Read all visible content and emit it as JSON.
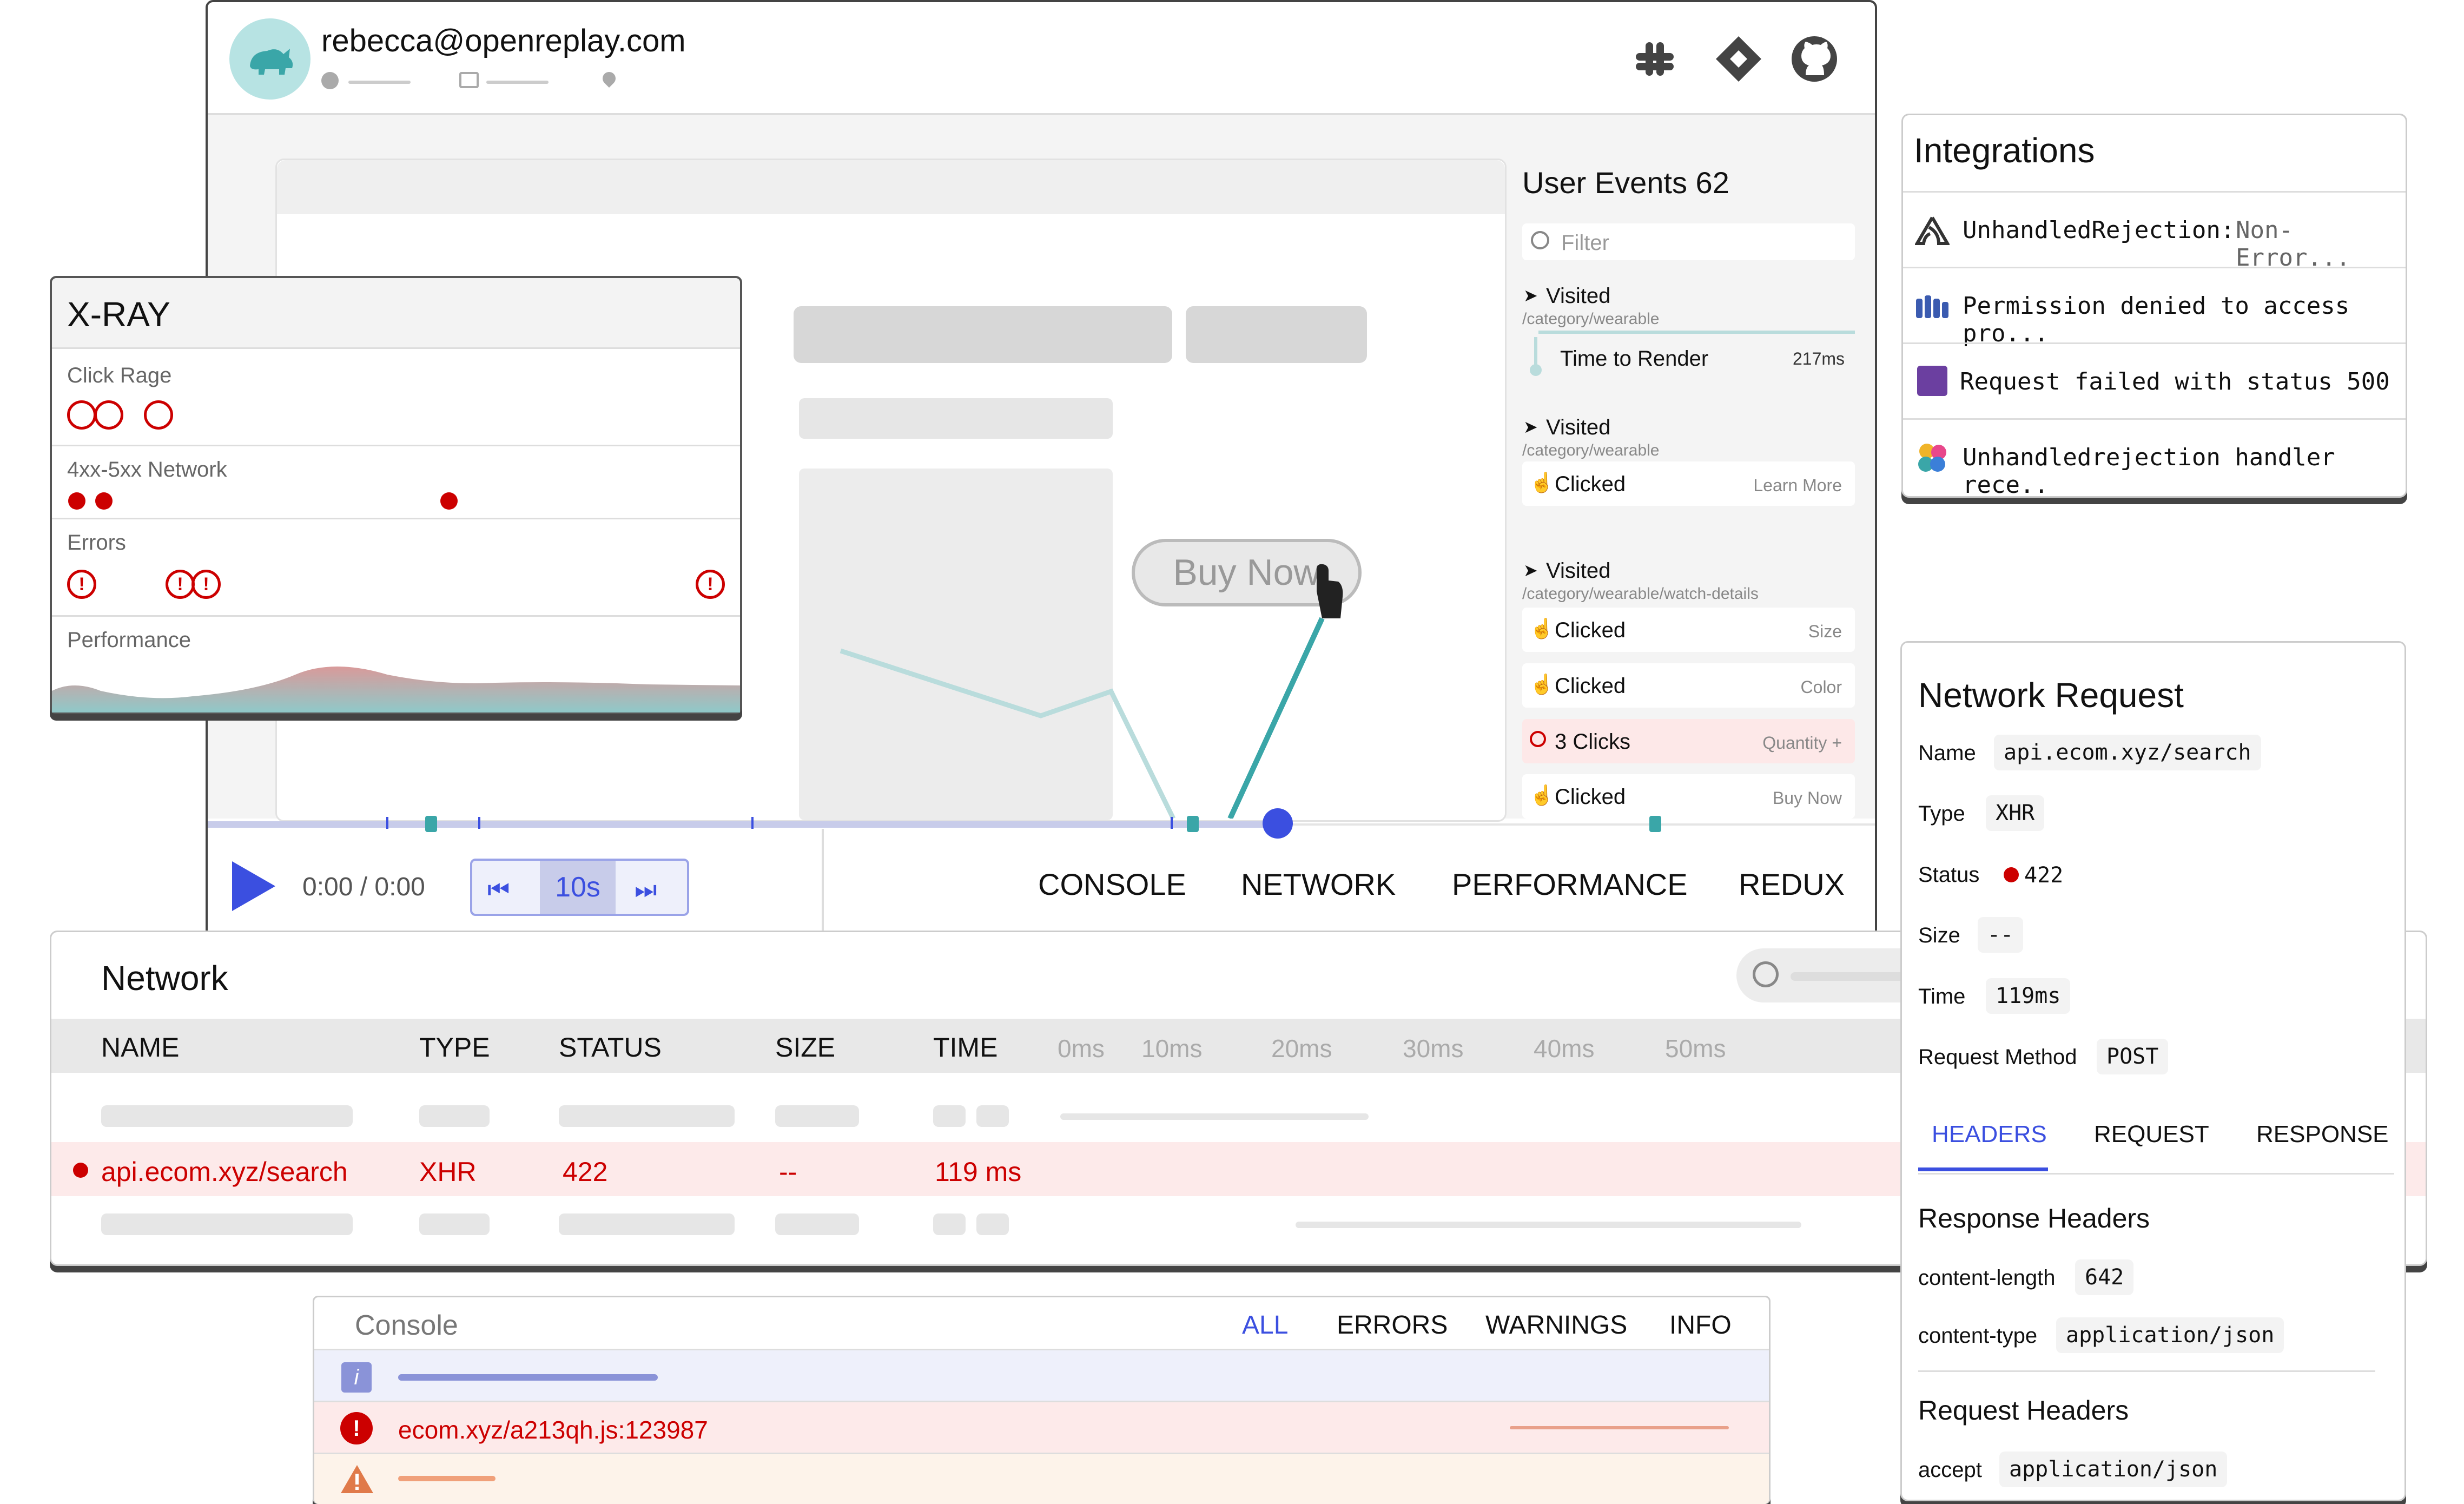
{
  "session": {
    "user_email": "rebecca@openreplay.com"
  },
  "header_icons": [
    "slack-icon",
    "jira-icon",
    "github-icon"
  ],
  "user_events": {
    "title": "User Events 62",
    "filter_placeholder": "Filter",
    "events": [
      {
        "type": "Visited",
        "path": "/category/wearable"
      },
      {
        "type": "Time to Render",
        "value": "217ms"
      },
      {
        "type": "Visited",
        "path": "/category/wearable"
      },
      {
        "type": "Clicked",
        "detail": "Learn More"
      },
      {
        "type": "Visited",
        "path": "/category/wearable/watch-details"
      },
      {
        "type": "Clicked",
        "detail": "Size"
      },
      {
        "type": "Clicked",
        "detail": "Color"
      },
      {
        "type": "3 Clicks",
        "detail": "Quantity +"
      },
      {
        "type": "Clicked",
        "detail": "Buy Now"
      }
    ]
  },
  "replay": {
    "buy_now_label": "Buy Now",
    "time_display": "0:00 / 0:00",
    "skip_label": "10s",
    "tabs": [
      "CONSOLE",
      "NETWORK",
      "PERFORMANCE",
      "REDUX"
    ]
  },
  "xray": {
    "title": "X-RAY",
    "rows": [
      "Click Rage",
      "4xx-5xx Network",
      "Errors",
      "Performance"
    ]
  },
  "integrations": {
    "title": "Integrations",
    "items": [
      {
        "icon": "sentry-icon",
        "text": "UnhandledRejection:",
        "extra": "Non-Error..."
      },
      {
        "icon": "datadog-icon",
        "text": "Permission denied to access pro...",
        "extra": ""
      },
      {
        "icon": "rollbar-icon",
        "text": "Request failed with status 500",
        "extra": ""
      },
      {
        "icon": "elastic-icon",
        "text": "Unhandledrejection handler rece..",
        "extra": ""
      }
    ]
  },
  "network": {
    "title": "Network",
    "columns": [
      "NAME",
      "TYPE",
      "STATUS",
      "SIZE",
      "TIME"
    ],
    "timeline_ticks": [
      "0ms",
      "10ms",
      "20ms",
      "30ms",
      "40ms",
      "50ms"
    ],
    "error_row": {
      "name": "api.ecom.xyz/search",
      "type": "XHR",
      "status": "422",
      "size": "--",
      "time": "119 ms"
    }
  },
  "network_request": {
    "title": "Network Request",
    "fields": [
      {
        "label": "Name",
        "value": "api.ecom.xyz/search"
      },
      {
        "label": "Type",
        "value": "XHR"
      },
      {
        "label": "Status",
        "value": "422"
      },
      {
        "label": "Size",
        "value": "--"
      },
      {
        "label": "Time",
        "value": "119ms"
      },
      {
        "label": "Request Method",
        "value": "POST"
      }
    ],
    "tabs": [
      "HEADERS",
      "REQUEST",
      "RESPONSE"
    ],
    "response_headers_title": "Response Headers",
    "response_headers": [
      {
        "label": "content-length",
        "value": "642"
      },
      {
        "label": "content-type",
        "value": "application/json"
      }
    ],
    "request_headers_title": "Request Headers",
    "request_headers": [
      {
        "label": "accept",
        "value": "application/json"
      }
    ]
  },
  "console": {
    "title": "Console",
    "filters": [
      "ALL",
      "ERRORS",
      "WARNINGS",
      "INFO"
    ],
    "error_text": "ecom.xyz/a213qh.js:123987"
  },
  "colors": {
    "accent_blue": "#3b4fe0",
    "error_red": "#cc0000",
    "teal": "#3aa6a8",
    "warning_orange": "#e07a4a"
  }
}
